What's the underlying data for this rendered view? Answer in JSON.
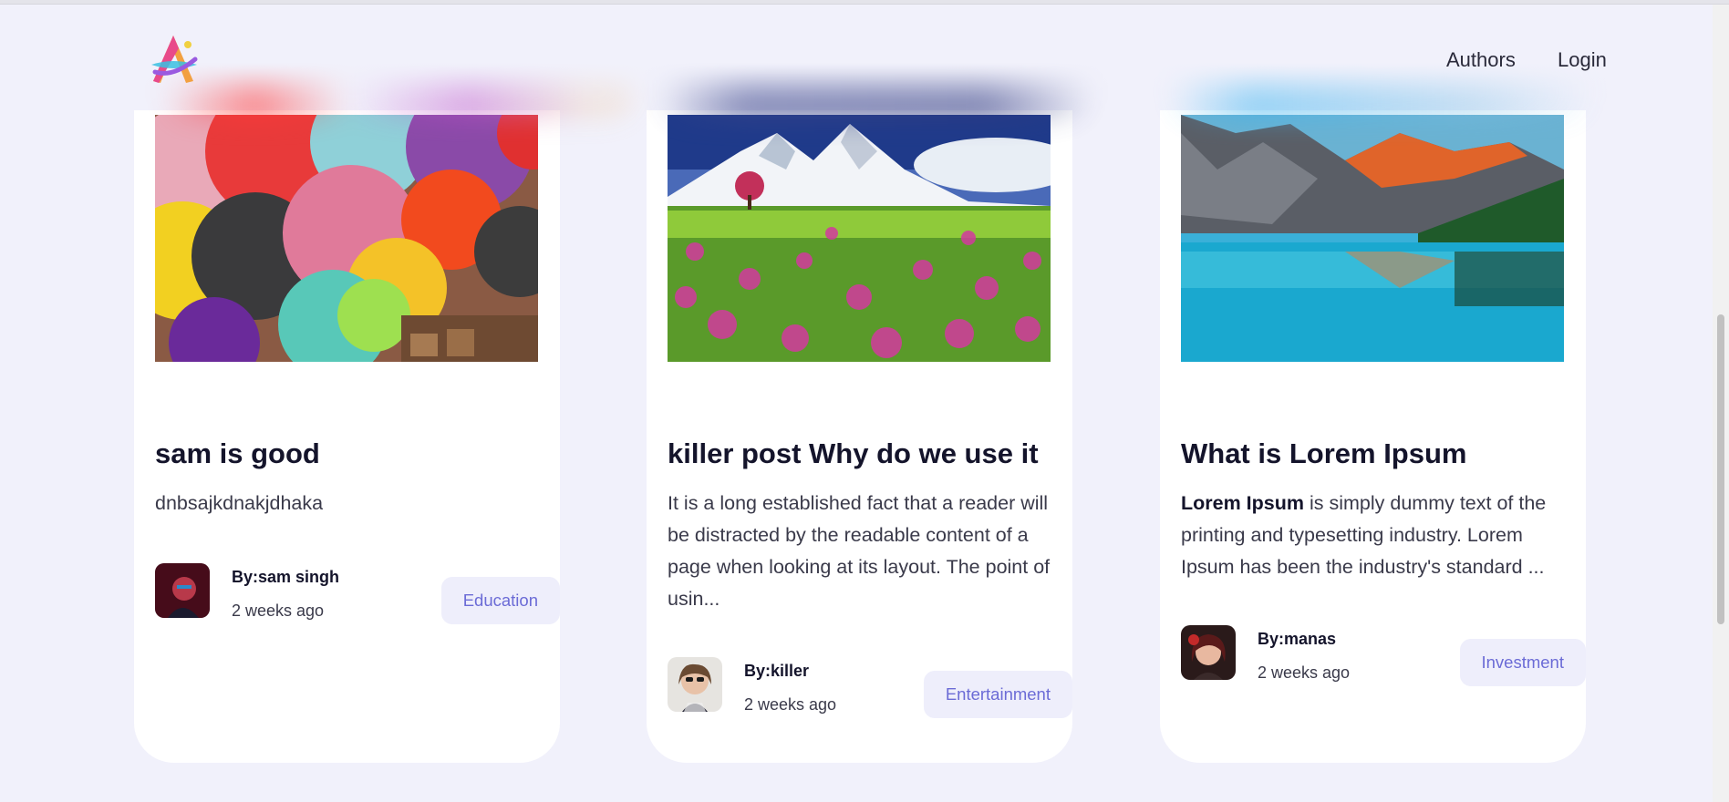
{
  "nav": {
    "authors": "Authors",
    "login": "Login"
  },
  "posts": [
    {
      "title": "sam is good",
      "excerpt": "dnbsajkdnakjdhaka",
      "author": "By:sam singh",
      "time": "2 weeks ago",
      "category": "Education"
    },
    {
      "title": "killer post Why do we use it",
      "excerpt": "It is a long established fact that a reader will be distracted by the readable content of a page when looking at its layout. The point of usin...",
      "author": "By:killer",
      "time": "2 weeks ago",
      "category": "Entertainment"
    },
    {
      "title": "What is Lorem Ipsum",
      "excerpt_bold": "Lorem Ipsum",
      "excerpt": " is simply dummy text of the printing and typesetting industry. Lorem Ipsum has been the industry's standard ...",
      "author": "By:manas",
      "time": "2 weeks ago",
      "category": "Investment"
    }
  ],
  "colors": {
    "background": "#f1f1fb",
    "tag_text": "#6b6bd6",
    "tag_bg": "#eeeefb"
  },
  "icons": {
    "logo": "multicolor-a-logo"
  }
}
